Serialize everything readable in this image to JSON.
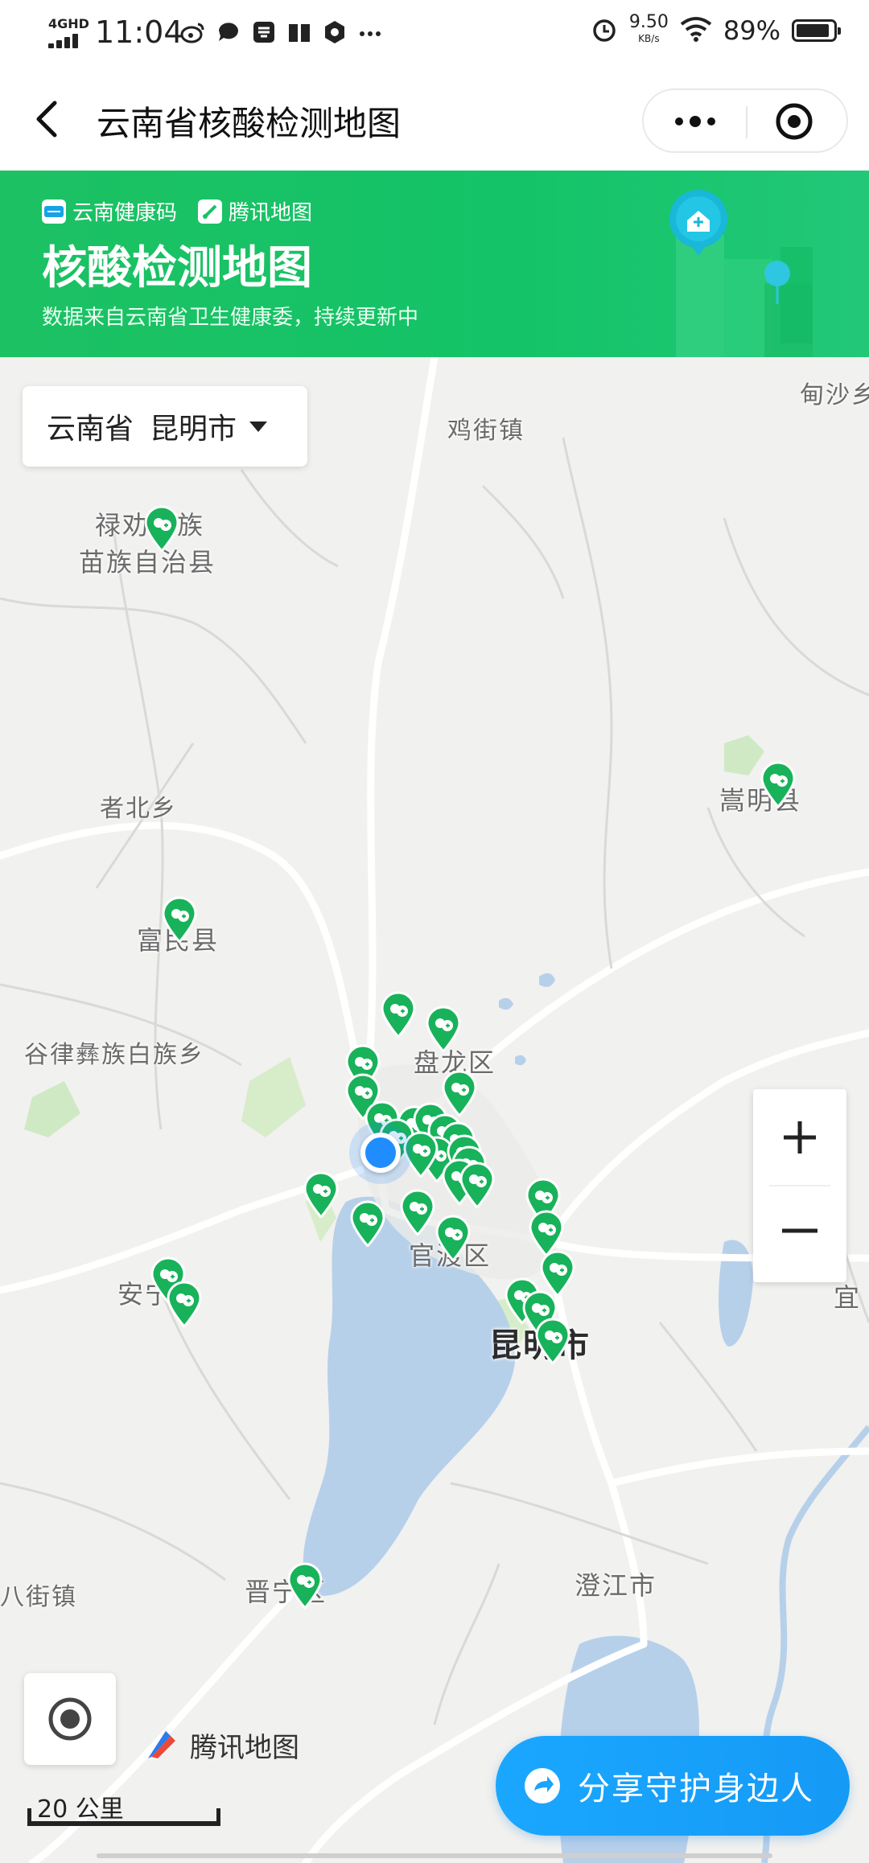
{
  "status_bar": {
    "network": "4GHD",
    "time": "11:04",
    "speed_value": "9.50",
    "speed_unit": "KB/s",
    "battery": "89%"
  },
  "nav": {
    "title": "云南省核酸检测地图"
  },
  "banner": {
    "brand_health": "云南健康码",
    "brand_tencent": "腾讯地图",
    "title": "核酸检测地图",
    "subtitle": "数据来自云南省卫生健康委，持续更新中"
  },
  "region_selector": {
    "province": "云南省",
    "city": "昆明市"
  },
  "places": {
    "jijie": "鸡街镇",
    "dianshao": "甸沙乡",
    "luquan_1": "禄劝彝族",
    "luquan_2": "苗族自治县",
    "zhebei": "者北乡",
    "songming": "嵩明县",
    "fumin": "富民县",
    "gulv": "谷律彝族白族乡",
    "panlong": "盘龙区",
    "guandu": "官渡区",
    "anning": "安宁市",
    "kunming": "昆明市",
    "yiliang": "宜",
    "bajie": "八街镇",
    "jinning": "晋宁区",
    "chengjiang": "澄江市"
  },
  "controls": {
    "zoom_in": "+",
    "zoom_out": "−",
    "map_brand": "腾讯地图",
    "scale": "20 公里",
    "share": "分享守护身边人"
  },
  "colors": {
    "accent_green": "#17c267",
    "pin_green": "#18b25a",
    "user_location": "#1f8dfd",
    "share_button": "#1aa3ff"
  }
}
